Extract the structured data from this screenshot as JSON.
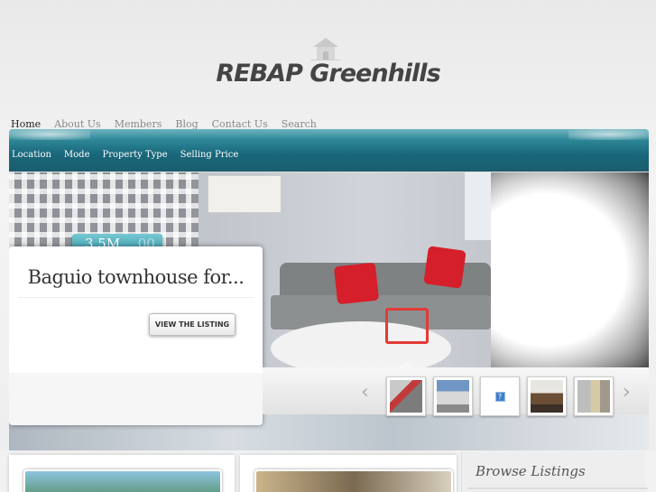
{
  "site": {
    "title": "REBAP Greenhills",
    "logo_icon": "house-icon"
  },
  "topnav": {
    "items": [
      {
        "label": "Home",
        "active": true
      },
      {
        "label": "About Us",
        "active": false
      },
      {
        "label": "Members",
        "active": false
      },
      {
        "label": "Blog",
        "active": false
      },
      {
        "label": "Contact Us",
        "active": false
      },
      {
        "label": "Search",
        "active": false
      }
    ]
  },
  "filters": {
    "items": [
      {
        "label": "Location"
      },
      {
        "label": "Mode"
      },
      {
        "label": "Property Type"
      },
      {
        "label": "Selling Price"
      }
    ]
  },
  "featured": {
    "price": "3.5M",
    "price_cents": ".00",
    "title": "Baguio townhouse for...",
    "cta_label": "VIEW THE LISTING"
  },
  "thumbnails": {
    "prev_icon": "chevron-left-icon",
    "next_icon": "chevron-right-icon",
    "items": [
      {
        "kind": "room-photo"
      },
      {
        "kind": "building-photo"
      },
      {
        "kind": "missing-image",
        "glyph": "?"
      },
      {
        "kind": "interior-photo"
      },
      {
        "kind": "exterior-photo"
      }
    ]
  },
  "sidebar": {
    "browse_title": "Browse Listings"
  },
  "colors": {
    "accent_teal": "#1b6b7c",
    "pillow_red": "#d51f2a",
    "missing_icon_blue": "#3f7fc9"
  }
}
